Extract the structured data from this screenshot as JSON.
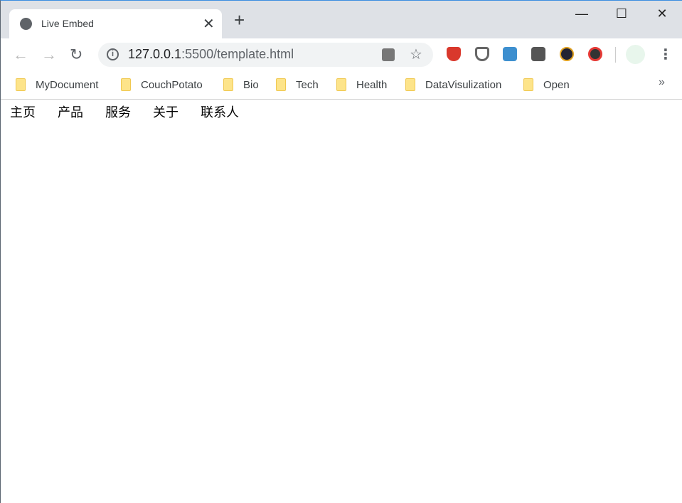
{
  "browser": {
    "tab_title": "Live Embed",
    "tab_close": "✕",
    "new_tab": "+",
    "window": {
      "minimize": "—",
      "maximize": "☐",
      "close": "✕"
    },
    "url_host": "127.0.0.1",
    "url_rest": ":5500/template.html",
    "more_menu": "⋮",
    "bookmarks": [
      "MyDocument",
      "CouchPotato",
      "Bio",
      "Tech",
      "Health",
      "DataVisulization",
      "Open"
    ],
    "bookmarks_overflow": "»"
  },
  "page": {
    "nav": [
      "主页",
      "产品",
      "服务",
      "关于",
      "联系人"
    ]
  }
}
